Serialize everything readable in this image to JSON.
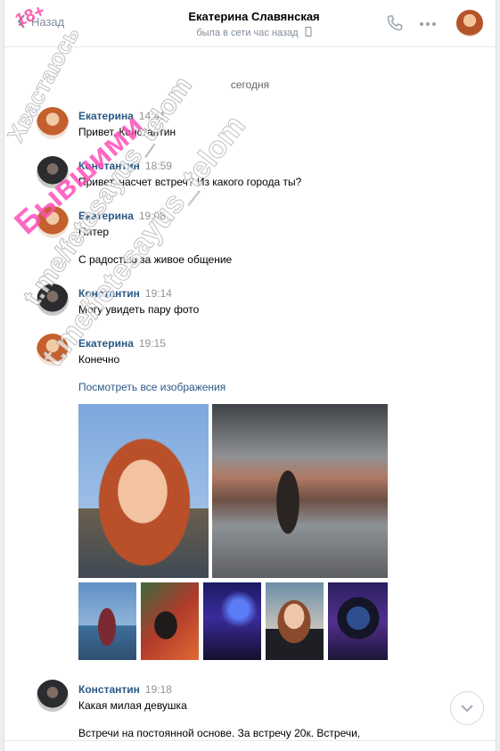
{
  "header": {
    "back_label": "Назад",
    "contact_name": "Екатерина Славянская",
    "status": "была в сети час назад"
  },
  "date_separator": "сегодня",
  "messages": [
    {
      "author": "Екатерина",
      "time": "14:41",
      "text": "Привет, Константин"
    },
    {
      "author": "Константин",
      "time": "18:59",
      "text": "Привет, насчет встреч? Из какого города ты?"
    },
    {
      "author": "Екатерина",
      "time": "19:08",
      "text": "Питер",
      "text2": "С радостью за живое общение"
    },
    {
      "author": "Константин",
      "time": "19:14",
      "text": "Могу увидеть пару фото"
    },
    {
      "author": "Екатерина",
      "time": "19:15",
      "text": "Конечно",
      "link": "Посмотреть все изображения"
    },
    {
      "author": "Константин",
      "time": "19:18",
      "text": "Какая милая девушка",
      "text2": "Встречи на постоянной основе. За встречу 20к. Встречи,"
    }
  ],
  "watermark": {
    "age": "18+",
    "line1": "Хвастаюсь",
    "line2": "Бывшими",
    "handle1": "t.me/fetesayus_telom",
    "handle2": "t.me/fetesayus_telom",
    "color": "#ff4fb8"
  },
  "colors": {
    "link": "#2a5885",
    "muted": "#818c99",
    "background": "#edeef0"
  }
}
